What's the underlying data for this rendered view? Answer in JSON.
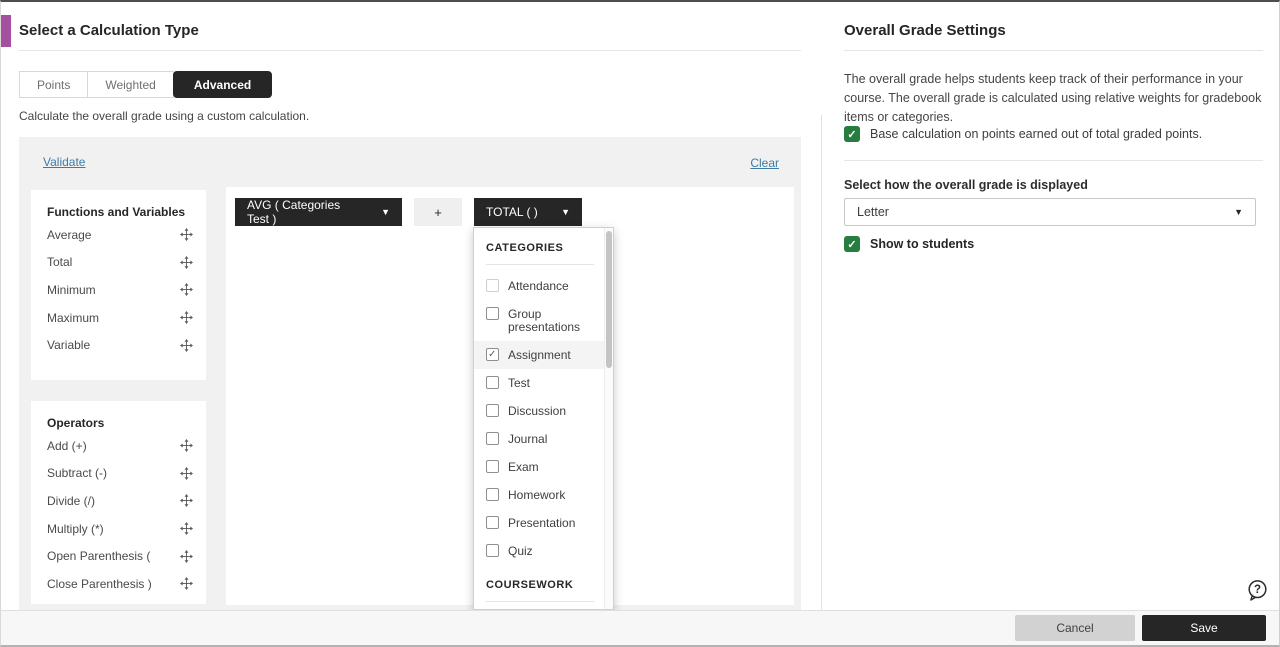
{
  "accent_color": "#a4509e",
  "left_panel": {
    "title": "Select a Calculation Type",
    "tabs": [
      {
        "label": "Points",
        "active": false
      },
      {
        "label": "Weighted",
        "active": false
      },
      {
        "label": "Advanced",
        "active": true
      }
    ],
    "description": "Calculate the overall grade using a custom calculation.",
    "builder": {
      "validate_link": "Validate",
      "clear_link": "Clear",
      "functions": {
        "heading": "Functions and Variables",
        "items": [
          {
            "label": "Average"
          },
          {
            "label": "Total"
          },
          {
            "label": "Minimum"
          },
          {
            "label": "Maximum"
          },
          {
            "label": "Variable"
          }
        ]
      },
      "operators": {
        "heading": "Operators",
        "items": [
          {
            "label": "Add (+)"
          },
          {
            "label": "Subtract (-)"
          },
          {
            "label": "Divide (/)"
          },
          {
            "label": "Multiply (*)"
          },
          {
            "label": "Open Parenthesis ("
          },
          {
            "label": "Close Parenthesis )"
          }
        ]
      },
      "expression": {
        "avg_chip": "AVG ( Categories Test )",
        "plus_chip": "+",
        "total_chip": "TOTAL ( )"
      },
      "dropdown": {
        "rows": [
          {
            "type": "header",
            "label": "CATEGORIES"
          },
          {
            "label": "Attendance",
            "muted": true
          },
          {
            "label": "Group presentations"
          },
          {
            "label": "Assignment",
            "checked": true,
            "highlight": true
          },
          {
            "label": "Test"
          },
          {
            "label": "Discussion"
          },
          {
            "label": "Journal"
          },
          {
            "label": "Exam"
          },
          {
            "label": "Homework"
          },
          {
            "label": "Presentation"
          },
          {
            "label": "Quiz"
          },
          {
            "type": "header",
            "label": "COURSEWORK"
          },
          {
            "label": "",
            "partial": true
          }
        ]
      }
    }
  },
  "right_panel": {
    "title": "Overall Grade Settings",
    "description": "The overall grade helps students keep track of their performance in your course. The overall grade is calculated using relative weights for gradebook items or categories.",
    "base_calculation_checkbox": {
      "label": "Base calculation on points earned out of total graded points.",
      "checked": true
    },
    "display_label": "Select how the overall grade is displayed",
    "display_select_value": "Letter",
    "show_to_students_checkbox": {
      "label": "Show to students",
      "checked": true
    },
    "checkbox_color": "#277c3f"
  },
  "footer": {
    "cancel_label": "Cancel",
    "save_label": "Save"
  }
}
